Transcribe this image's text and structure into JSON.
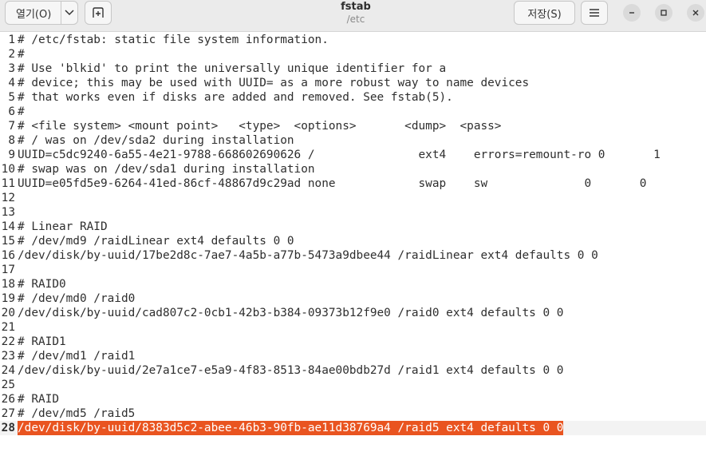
{
  "header": {
    "open_label": "열기(O)",
    "title": "fstab",
    "subtitle": "/etc",
    "save_label": "저장(S)"
  },
  "editor": {
    "current_line": 28,
    "lines": [
      "# /etc/fstab: static file system information.",
      "#",
      "# Use 'blkid' to print the universally unique identifier for a",
      "# device; this may be used with UUID= as a more robust way to name devices",
      "# that works even if disks are added and removed. See fstab(5).",
      "#",
      "# <file system> <mount point>   <type>  <options>       <dump>  <pass>",
      "# / was on /dev/sda2 during installation",
      "UUID=c5dc9240-6a55-4e21-9788-668602690626 /               ext4    errors=remount-ro 0       1",
      "# swap was on /dev/sda1 during installation",
      "UUID=e05fd5e9-6264-41ed-86cf-48867d9c29ad none            swap    sw              0       0",
      "",
      "",
      "# Linear RAID",
      "# /dev/md9 /raidLinear ext4 defaults 0 0",
      "/dev/disk/by-uuid/17be2d8c-7ae7-4a5b-a77b-5473a9dbee44 /raidLinear ext4 defaults 0 0",
      "",
      "# RAID0",
      "# /dev/md0 /raid0",
      "/dev/disk/by-uuid/cad807c2-0cb1-42b3-b384-09373b12f9e0 /raid0 ext4 defaults 0 0",
      "",
      "# RAID1",
      "# /dev/md1 /raid1",
      "/dev/disk/by-uuid/2e7a1ce7-e5a9-4f83-8513-84ae00bdb27d /raid1 ext4 defaults 0 0",
      "",
      "# RAID",
      "# /dev/md5 /raid5",
      "/dev/disk/by-uuid/8383d5c2-abee-46b3-90fb-ae11d38769a4 /raid5 ext4 defaults 0 0"
    ]
  },
  "icons": {
    "dropdown": "chevron-down-icon",
    "new_tab": "new-tab-icon",
    "menu": "hamburger-menu-icon",
    "minimize": "minimize-icon",
    "maximize": "maximize-icon",
    "close": "close-icon"
  },
  "colors": {
    "selection": "#e95420",
    "headerbar": "#ebebeb"
  }
}
